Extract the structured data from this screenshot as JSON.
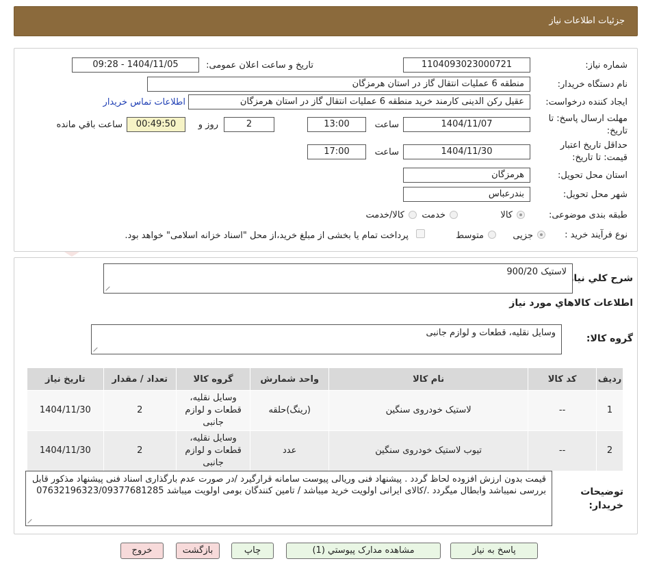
{
  "header": {
    "title": "جزئیات اطلاعات نیاز"
  },
  "form": {
    "need_number_label": "شماره نیاز:",
    "need_number": "1104093023000721",
    "announce_label": "تاریخ و ساعت اعلان عمومی:",
    "announce_value": "1404/11/05 - 09:28",
    "buyer_org_label": "نام دستگاه خریدار:",
    "buyer_org": "منطقه 6 عملیات انتقال گاز در استان هرمزگان",
    "creator_label": "ایجاد کننده درخواست:",
    "creator": "عقیل رکن الدینی کارمند خرید منطقه 6 عملیات انتقال گاز در استان هرمزگان",
    "contact_link": "اطلاعات تماس خریدار",
    "deadline_label_1": "مهلت ارسال پاسخ: تا",
    "deadline_label_2": "تاریخ:",
    "deadline_date": "1404/11/07",
    "time_label": "ساعت",
    "deadline_time": "13:00",
    "days_value": "2",
    "days_label": "روز و",
    "remaining_time": "00:49:50",
    "remaining_label": "ساعت باقي مانده",
    "validity_label_1": "حداقل تاریخ اعتبار",
    "validity_label_2": "قیمت: تا تاریخ:",
    "validity_date": "1404/11/30",
    "validity_time_label": "ساعت",
    "validity_time": "17:00",
    "province_label": "استان محل تحویل:",
    "province": "هرمزگان",
    "city_label": "شهر محل تحویل:",
    "city": "بندرعباس",
    "category_label": "طبقه بندی موضوعی:",
    "category_options": [
      "کالا",
      "خدمت",
      "کالا/خدمت"
    ],
    "purchase_type_label": "نوع فرآیند خرید :",
    "purchase_options": [
      "جزیی",
      "متوسط"
    ],
    "payment_note": "پرداخت تمام یا بخشی از مبلغ خرید،از محل \"اسناد خزانه اسلامی\" خواهد بود."
  },
  "details": {
    "summary_label": "شرح کلي نياز:",
    "summary_value": "لاستیک 900/20",
    "goods_info_title": "اطلاعات کالاهاي مورد نياز",
    "goods_group_label": "گروه کالا:",
    "goods_group_value": "وسایل نقلیه، قطعات و لوازم جانبی",
    "buyer_notes_label_1": "توضیحات",
    "buyer_notes_label_2": "خریدار:",
    "buyer_notes": "قیمت بدون ارزش افزوده لحاظ گردد . پیشنهاد فنی وریالی پیوست سامانه قرارگیرد /در صورت عدم بارگذاری اسناد فنی پیشنهاد مذکور قابل بررسی نمیباشد وابطال میگردد ./کالای ایرانی اولویت خرید میباشد / تامین کنندگان بومی اولویت میباشد 07632196323/09377681285"
  },
  "table": {
    "headers": [
      "ردیف",
      "کد کالا",
      "نام کالا",
      "واحد شمارش",
      "گروه کالا",
      "تعداد / مقدار",
      "تاریخ نیاز"
    ],
    "rows": [
      [
        "1",
        "--",
        "لاستیک خودروی سنگین",
        "(رینگ)حلقه",
        "وسایل نقلیه، قطعات و لوازم جانبی",
        "2",
        "1404/11/30"
      ],
      [
        "2",
        "--",
        "تیوب لاستیک خودروی سنگین",
        "عدد",
        "وسایل نقلیه، قطعات و لوازم جانبی",
        "2",
        "1404/11/30"
      ]
    ]
  },
  "buttons": {
    "reply": "پاسخ به نیاز",
    "view_docs": "مشاهده مدارک پیوستي (1)",
    "print": "چاپ",
    "back": "بازگشت",
    "exit": "خروج"
  },
  "colors": {
    "header_bg": "#8b6a3c",
    "button_bg": "#e9f6e4",
    "button_red_bg": "#f7dada",
    "highlight": "#f6f3c6",
    "link": "#1f3fb4"
  }
}
